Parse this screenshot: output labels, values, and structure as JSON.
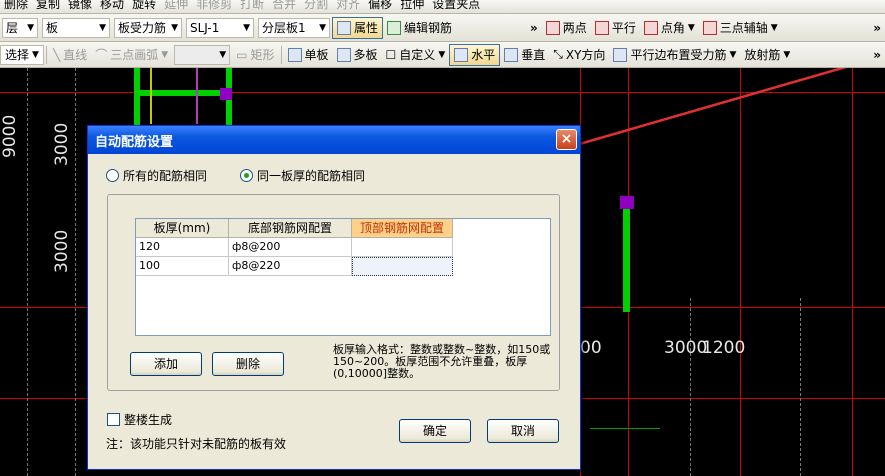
{
  "toolbar_top": {
    "items": [
      "删除",
      "复制",
      "镜像",
      "移动",
      "旋转",
      "延伸",
      "非修剪",
      "打断",
      "合并",
      "分割",
      "对齐",
      "偏移",
      "拉伸",
      "设置夹点"
    ]
  },
  "toolbar_props": {
    "layer_combo": "层",
    "type_combo": "板",
    "rebar_combo": "板受力筋",
    "code_combo": "SLJ-1",
    "floor_combo": "分层板1",
    "properties_btn": "属性",
    "edit_rebar_btn": "编辑钢筋",
    "two_point": "两点",
    "parallel": "平行",
    "point_angle": "点角",
    "three_point_aux": "三点辅轴",
    "overflow": "»"
  },
  "toolbar_draw": {
    "select": "选择",
    "line": "直线",
    "arc": "三点画弧",
    "rect": "矩形",
    "single_board": "单板",
    "multi_board": "多板",
    "custom": "自定义",
    "horizontal": "水平",
    "vertical": "垂直",
    "xy_dir": "XY方向",
    "parallel_edge": "平行边布置受力筋",
    "radial": "放射筋",
    "overflow": "»"
  },
  "canvas": {
    "dim_9000": "9000",
    "dim_3000_a": "3000",
    "dim_3000_b": "3000",
    "dim_right_a": "00",
    "dim_right_b": "3000",
    "dim_right_c": "1200"
  },
  "dialog": {
    "title": "自动配筋设置",
    "close": "×",
    "radio_all_same": "所有的配筋相同",
    "radio_same_thickness": "同一板厚的配筋相同",
    "table": {
      "headers": [
        "板厚(mm)",
        "底部钢筋网配置",
        "顶部钢筋网配置"
      ],
      "rows": [
        [
          "120",
          "ф8@200",
          ""
        ],
        [
          "100",
          "ф8@220",
          ""
        ]
      ]
    },
    "add_btn": "添加",
    "delete_btn": "删除",
    "hint": "板厚输入格式：整数或整数~整数，如150或150~200。板厚范围不允许重叠，板厚(0,10000]整数。",
    "whole_building": "整楼生成",
    "note": "注：该功能只针对未配筋的板有效",
    "ok_btn": "确定",
    "cancel_btn": "取消"
  },
  "colors": {
    "title_bar": "#0a57e0",
    "arrow": "#e03030",
    "grid_line": "#d00000",
    "beam": "#00d000",
    "selected_header": "#ffd08a"
  }
}
